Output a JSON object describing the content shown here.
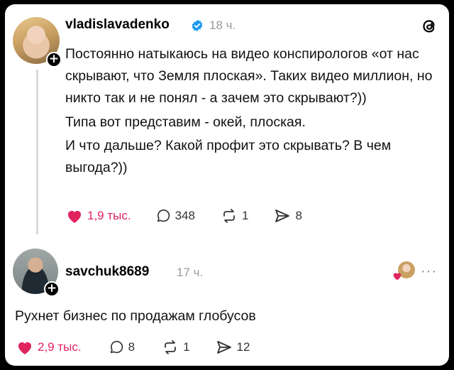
{
  "post": {
    "username": "vladislavadenko",
    "time": "18 ч.",
    "lines": [
      "Постоянно натыкаюсь на видео конспирологов «от нас скрывают, что Земля плоская». Таких видео миллион, но никто так и не понял - а зачем это скрывают?))",
      "Типа вот представим - окей, плоская.",
      "И что дальше? Какой профит это скрывать? В чем выгода?))"
    ],
    "likes": "1,9 тыс.",
    "comments": "348",
    "reposts": "1",
    "shares": "8"
  },
  "reply": {
    "username": "savchuk8689",
    "time": "17 ч.",
    "text": "Рухнет бизнес по продажам глобусов",
    "likes": "2,9 тыс.",
    "comments": "8",
    "reposts": "1",
    "shares": "12"
  },
  "icons": {
    "app": "threads-icon",
    "verified": "verified-badge-icon",
    "like": "heart-icon",
    "comment": "comment-icon",
    "repost": "repost-icon",
    "share": "share-icon",
    "more": "more-icon",
    "liked_by_author": "author-like-avatar-icon"
  },
  "colors": {
    "like": "#e0245e",
    "verified": "#1d9bf0",
    "text": "#111111",
    "muted": "#9a9a9a"
  }
}
